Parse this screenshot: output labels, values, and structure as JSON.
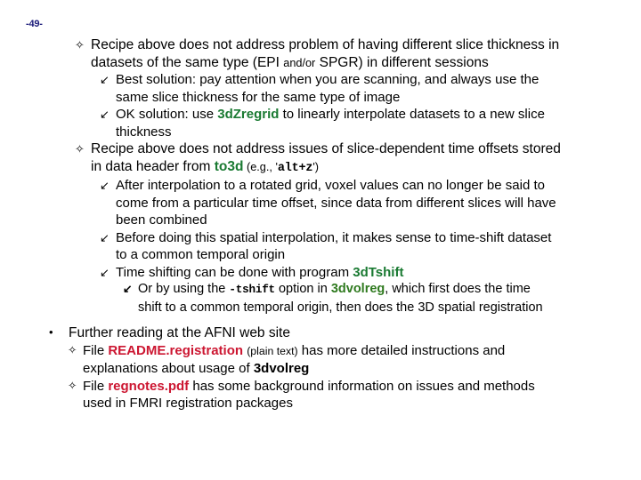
{
  "slide": {
    "page_number": "-49-",
    "bullets": {
      "b1": {
        "marker": "✧",
        "line1": "Recipe above does not address problem of having different slice thickness in",
        "line2_a": "datasets of the same type (EPI ",
        "line2_small": "and/or",
        "line2_b": " SPGR) in different sessions"
      },
      "b1s1": {
        "marker": "↙",
        "text_a": "Best solution: pay attention when you are scanning, and always use the",
        "text_b": "same slice thickness for the same type of image"
      },
      "b1s2": {
        "marker": "↙",
        "text_a": "OK solution: use ",
        "code": "3dZregrid",
        "text_b": " to linearly interpolate datasets to a new slice",
        "text_c": "thickness"
      },
      "b2": {
        "marker": "✧",
        "line1": "Recipe above does not address issues of slice-dependent time offsets stored",
        "line2_a": "in data header from ",
        "code": "to3d",
        "line2_b": " (e.g., '",
        "option": "alt+z",
        "line2_c": "')"
      },
      "b2s1": {
        "marker": "↙",
        "text_a": "After interpolation to a rotated grid, voxel values can no longer be said to",
        "text_b": "come from a particular time offset, since data from different slices will have",
        "text_c": "been combined"
      },
      "b2s2": {
        "marker": "↙",
        "text_a": "Before doing this spatial interpolation, it makes sense to time-shift dataset",
        "text_b": "to a common temporal origin"
      },
      "b2s3": {
        "marker": "↙",
        "text_a": "Time shifting can be done with program ",
        "code": "3dTshift"
      },
      "b2s3a": {
        "marker": "↙",
        "text_a": "Or by using the ",
        "option": "-tshift",
        "text_b": " option in ",
        "code": "3dvolreg",
        "text_c": ", which first does the time",
        "text_d": "shift to a common temporal origin, then does the 3D spatial registration"
      },
      "b3": {
        "marker": "•",
        "text": "Further reading at the AFNI web site"
      },
      "b3s1": {
        "marker": "✧",
        "text_a": "File ",
        "file": "README.registration",
        "text_b": " ",
        "note": "(plain text)",
        "text_c": " has more detailed instructions and",
        "text_d": "explanations about usage of ",
        "code": "3dvolreg"
      },
      "b3s2": {
        "marker": "✧",
        "text_a": "File ",
        "file": "regnotes.pdf",
        "text_b": " has some background information on issues and methods",
        "text_c": "used in FMRI registration packages"
      }
    }
  }
}
